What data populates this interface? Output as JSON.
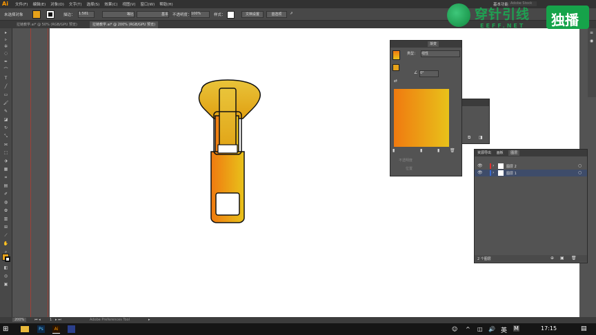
{
  "menubar": {
    "app_logo": "Ai",
    "items": [
      "文件(F)",
      "编辑(E)",
      "对象(O)",
      "文字(T)",
      "选择(S)",
      "效果(C)",
      "视图(V)",
      "窗口(W)",
      "帮助(H)"
    ],
    "workspace": "基本功能",
    "search_placeholder": "Adobe Stock"
  },
  "controlbar": {
    "selection": "未选择对象",
    "stroke_label": "描边：",
    "stroke_value": "1.581",
    "brush_label": "等比",
    "profile_label": "基本",
    "opacity_label": "不透明度：",
    "opacity_value": "100%",
    "style_label": "样式：",
    "doc_setup": "文档设置",
    "prefs": "首选项",
    "fill_color": "#e6a21a",
    "stroke_color": "#111111"
  },
  "tabs": [
    {
      "label": "拉链教学.ai* @ 50% (RGB/GPU 预览)",
      "active": false
    },
    {
      "label": "拉链教学.ai* @ 200% (RGB/GPU 预览)",
      "active": true
    }
  ],
  "statusbar": {
    "zoom": "200%",
    "page": "1",
    "tool_name": "Adobe Preferences Tool"
  },
  "taskbar": {
    "ime": "英",
    "ime_m": "M",
    "time": "17:15"
  },
  "watermark": {
    "brand": "穿针引线",
    "site": "EEFF.NET",
    "tag": "独播"
  },
  "gradient_panel": {
    "title": "渐变",
    "type_label": "类型：",
    "type_value": "线性",
    "angle_value": "0°",
    "opacity_label": "不透明度",
    "position_label": "位置",
    "start_color": "#f07a10",
    "end_color": "#e8c21a"
  },
  "layers_panel": {
    "tabs": [
      "资源导出",
      "画板",
      "图层"
    ],
    "active_tab": "图层",
    "layers": [
      {
        "name": "图层 2",
        "color": "#e03030"
      },
      {
        "name": "图层 1",
        "color": "#3a6ad0"
      }
    ],
    "count": "2 个图层"
  }
}
